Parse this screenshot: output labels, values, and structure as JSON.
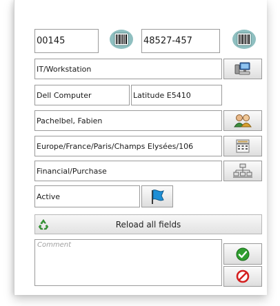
{
  "form": {
    "asset_tag": "00145",
    "serial_number": "48527-457",
    "category": "IT/Workstation",
    "manufacturer": "Dell Computer",
    "model": "Latitude E5410",
    "user": "Pachelbel, Fabien",
    "location": "Europe/France/Paris/Champs Elysées/106",
    "cost_center": "Financial/Purchase",
    "status": "Active",
    "reload_label": "Reload all fields",
    "comment_placeholder": "Comment"
  },
  "colors": {
    "flag": "#1e8fd6",
    "ok": "#2f9e2f",
    "cancel": "#d42020",
    "recycle": "#3aa63a"
  },
  "icons": {
    "barcode": "barcode-icon",
    "workstation": "workstation-icon",
    "users": "users-icon",
    "location": "building-icon",
    "hierarchy": "org-chart-icon",
    "flag": "flag-icon",
    "recycle": "recycle-icon",
    "ok": "check-icon",
    "cancel": "cancel-icon"
  }
}
